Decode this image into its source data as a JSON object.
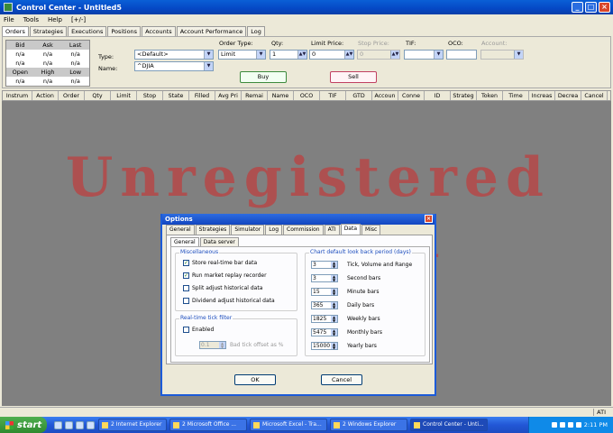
{
  "window": {
    "title": "Control Center - Untitled5"
  },
  "menu": [
    "File",
    "Tools",
    "Help",
    "[+/-]"
  ],
  "tabs": [
    "Orders",
    "Strategies",
    "Executions",
    "Positions",
    "Accounts",
    "Account Performance",
    "Log"
  ],
  "market": {
    "hdr1": [
      "Bid",
      "Ask",
      "Last"
    ],
    "row1": [
      "n/a",
      "n/a",
      "n/a"
    ],
    "row2": [
      "n/a",
      "n/a",
      "n/a"
    ],
    "hdr2": [
      "Open",
      "High",
      "Low"
    ],
    "row3": [
      "n/a",
      "n/a",
      "n/a"
    ]
  },
  "order_entry": {
    "type_label": "Type:",
    "type_value": "<Default>",
    "name_label": "Name:",
    "name_value": "^DJIA",
    "order_type_label": "Order Type:",
    "order_type_value": "Limit",
    "qty_label": "Qty:",
    "qty_value": "1",
    "limit_price_label": "Limit Price:",
    "limit_price_value": "0",
    "stop_price_label": "Stop Price:",
    "stop_price_value": "0",
    "tif_label": "TIF:",
    "tif_value": "",
    "oco_label": "OCO:",
    "oco_value": "",
    "account_label": "Account:",
    "account_value": "",
    "buy": "Buy",
    "sell": "Sell"
  },
  "columns": [
    "Instrum",
    "Action",
    "Order",
    "Qty",
    "Limit",
    "Stop",
    "State",
    "Filled",
    "Avg Pri",
    "Remai",
    "Name",
    "OCO",
    "TIF",
    "GTD",
    "Accoun",
    "Conne",
    "ID",
    "Strateg",
    "Token",
    "Time",
    "Increas",
    "Decrea",
    "Cancel"
  ],
  "watermark": [
    "Unregistered",
    "Version"
  ],
  "status": {
    "ati": "ATI"
  },
  "dialog": {
    "title": "Options",
    "tabs": [
      "General",
      "Strategies",
      "Simulator",
      "Log",
      "Commission",
      "ATI",
      "Data",
      "Misc"
    ],
    "subtabs": [
      "General",
      "Data server"
    ],
    "misc_title": "Miscellaneous",
    "checks": [
      {
        "label": "Store real-time bar data",
        "checked": true
      },
      {
        "label": "Run market replay recorder",
        "checked": true
      },
      {
        "label": "Split adjust historical data",
        "checked": false
      },
      {
        "label": "Dividend adjust historical data",
        "checked": false
      }
    ],
    "tick_title": "Real-time tick filter",
    "enabled_label": "Enabled",
    "enabled_checked": false,
    "bad_tick_value": "0.1",
    "bad_tick_label": "Bad tick offset as %",
    "lookback_title": "Chart default look back period (days)",
    "lookback": [
      {
        "value": "3",
        "label": "Tick, Volume and Range"
      },
      {
        "value": "3",
        "label": "Second bars"
      },
      {
        "value": "15",
        "label": "Minute bars"
      },
      {
        "value": "365",
        "label": "Daily bars"
      },
      {
        "value": "1825",
        "label": "Weekly bars"
      },
      {
        "value": "5475",
        "label": "Monthly bars"
      },
      {
        "value": "15000",
        "label": "Yearly bars"
      }
    ],
    "ok": "OK",
    "cancel": "Cancel"
  },
  "taskbar": {
    "start": "start",
    "tasks": [
      "2 Internet Explorer",
      "2 Microsoft Office ...",
      "Microsoft Excel - Tra...",
      "2 Windows Explorer",
      "Control Center - Unti..."
    ],
    "clock": "2:11 PM"
  }
}
